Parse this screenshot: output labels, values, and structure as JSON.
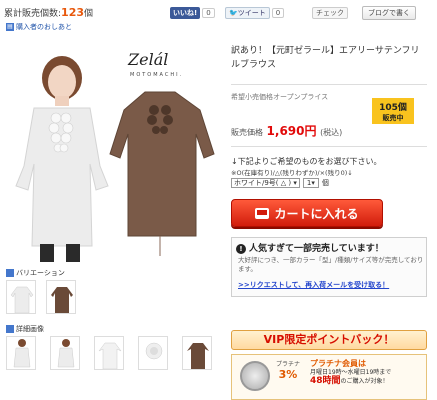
{
  "top": {
    "sales_prefix": "累計販売個数:",
    "sales_count": "123",
    "sales_suffix": "個",
    "reviews_link": "購入者のおしあと",
    "like_label": "いいね!",
    "like_count": "0",
    "tweet_label": "ツイート",
    "tweet_count": "0",
    "check_label": "チェック",
    "blog_button": "ブログで書く"
  },
  "brand": {
    "name": "Zelál",
    "sub": "MOTOMACHI."
  },
  "product": {
    "title": "訳あり！【元町ゼラール】エアリーサテンフリルブラウス",
    "msrp_label": "希望小売価格オープンプライス",
    "stock_count": "105個",
    "stock_label": "販売中",
    "price_label": "販売価格",
    "price": "1,690円",
    "tax": "(税込)"
  },
  "options": {
    "heading": "↓下記よりご希望のものをお選び下さい。",
    "note": "※O(在庫有り)/△(残りわずか)/×(残り0)↓",
    "color_size_value": "ホワイト/9号( △ )",
    "qty_value": "1",
    "qty_unit": "個"
  },
  "cart": {
    "label": "カートに入れる"
  },
  "popular": {
    "heading": "人気すぎて一部完売しています！",
    "text": "大好評につき、一部カラー「型」/種類/サイズ等が完売しております。",
    "link": ">>リクエストして、再入荷メールを受け取る！"
  },
  "vip": {
    "title": "VIP限定ポイントバック！",
    "rank": "プラチナ",
    "percent": "3%",
    "member": "プラチナ会員は",
    "schedule": "月曜日19時〜水曜日19時まで",
    "hours": "48時間",
    "hours_suffix": "のご購入が対象！"
  },
  "variations": {
    "label": "バリエーション",
    "detail_label": "詳細画像"
  },
  "colors": {
    "accent_red": "#e20a0a",
    "badge_yellow": "#f9c31e",
    "link_blue": "#2244cc",
    "brand_brown": "#7a5a48"
  }
}
